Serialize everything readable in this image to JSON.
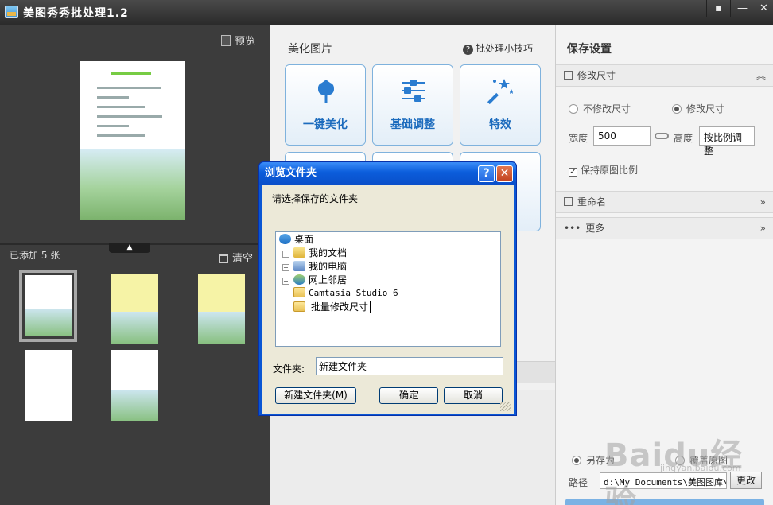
{
  "window": {
    "title": "美图秀秀批处理1.2",
    "controls": [
      "▪",
      "—",
      "✕"
    ]
  },
  "left": {
    "preview_label": "预览",
    "added_count": "已添加 5 张",
    "clear_label": "清空"
  },
  "center": {
    "title": "美化图片",
    "tips_label": "批处理小技巧",
    "tools": [
      {
        "label": "一键美化",
        "icon": "tulip-icon"
      },
      {
        "label": "基础调整",
        "icon": "sliders-icon"
      },
      {
        "label": "特效",
        "icon": "magic-wand-icon"
      }
    ]
  },
  "right": {
    "title": "保存设置",
    "resize": {
      "header": "修改尺寸",
      "no_resize": "不修改尺寸",
      "resize": "修改尺寸",
      "width_label": "宽度",
      "width_value": "500",
      "height_label": "高度",
      "height_value": "按比例调整",
      "keep_ratio": "保持原图比例"
    },
    "rename_header": "重命名",
    "more_header": "更多",
    "save": {
      "option_other": "另存为",
      "option_overwrite": "覆盖原图",
      "path_label": "路径",
      "path_value": "d:\\My Documents\\美图图库\\",
      "change_label": "更改"
    }
  },
  "dialog": {
    "title": "浏览文件夹",
    "help": "?",
    "close": "✕",
    "prompt": "请选择保存的文件夹",
    "tree": [
      {
        "label": "桌面",
        "icon": "desktop-icon"
      },
      {
        "label": "我的文档",
        "icon": "my-documents-icon"
      },
      {
        "label": "我的电脑",
        "icon": "my-computer-icon"
      },
      {
        "label": "网上邻居",
        "icon": "network-icon"
      },
      {
        "label": "Camtasia Studio 6",
        "icon": "folder-icon"
      },
      {
        "label": "批量修改尺寸",
        "icon": "folder-icon"
      }
    ],
    "folder_label": "文件夹:",
    "folder_value": "新建文件夹",
    "new_folder_button": "新建文件夹(M)",
    "ok_button": "确定",
    "cancel_button": "取消"
  },
  "watermark": {
    "text": "Baidu经验",
    "sub": "jingyan.baidu.com"
  }
}
